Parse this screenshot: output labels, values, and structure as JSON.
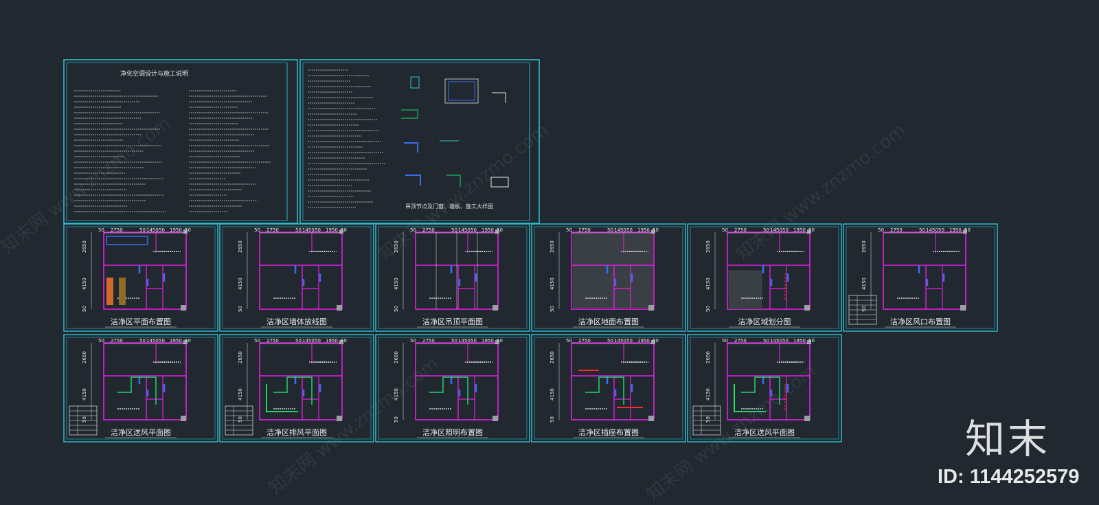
{
  "colors": {
    "background": "#212830",
    "frame": "#2ec4d4",
    "wall": "#e020e0",
    "equipment": "#3a6ef0",
    "pipe": "#22d66b",
    "mark": "#ff2a2a",
    "text": "#e8e8e8"
  },
  "notes_sheet": {
    "title": "净化空调设计与施工说明"
  },
  "details_sheet": {
    "caption": "吊顶节点及门窗、墙板、施工大样图"
  },
  "dimensions": {
    "top": [
      "50",
      "2750",
      "50",
      "1450",
      "50",
      "1950",
      "50"
    ],
    "side": [
      "2650",
      "4150",
      "50"
    ]
  },
  "sheets": [
    {
      "title": "洁净区平面布置图"
    },
    {
      "title": "洁净区墙体放线图"
    },
    {
      "title": "洁净区吊顶平面图"
    },
    {
      "title": "洁净区地面布置图"
    },
    {
      "title": "洁净区域划分图"
    },
    {
      "title": "洁净区风口布置图"
    },
    {
      "title": "洁净区送风平面图"
    },
    {
      "title": "洁净区排风平面图"
    },
    {
      "title": "洁净区照明布置图"
    },
    {
      "title": "洁净区插座布置图"
    },
    {
      "title": "洁净区送风平面图"
    }
  ],
  "brand": {
    "logo": "知末",
    "id_label": "ID: 1144252579"
  }
}
